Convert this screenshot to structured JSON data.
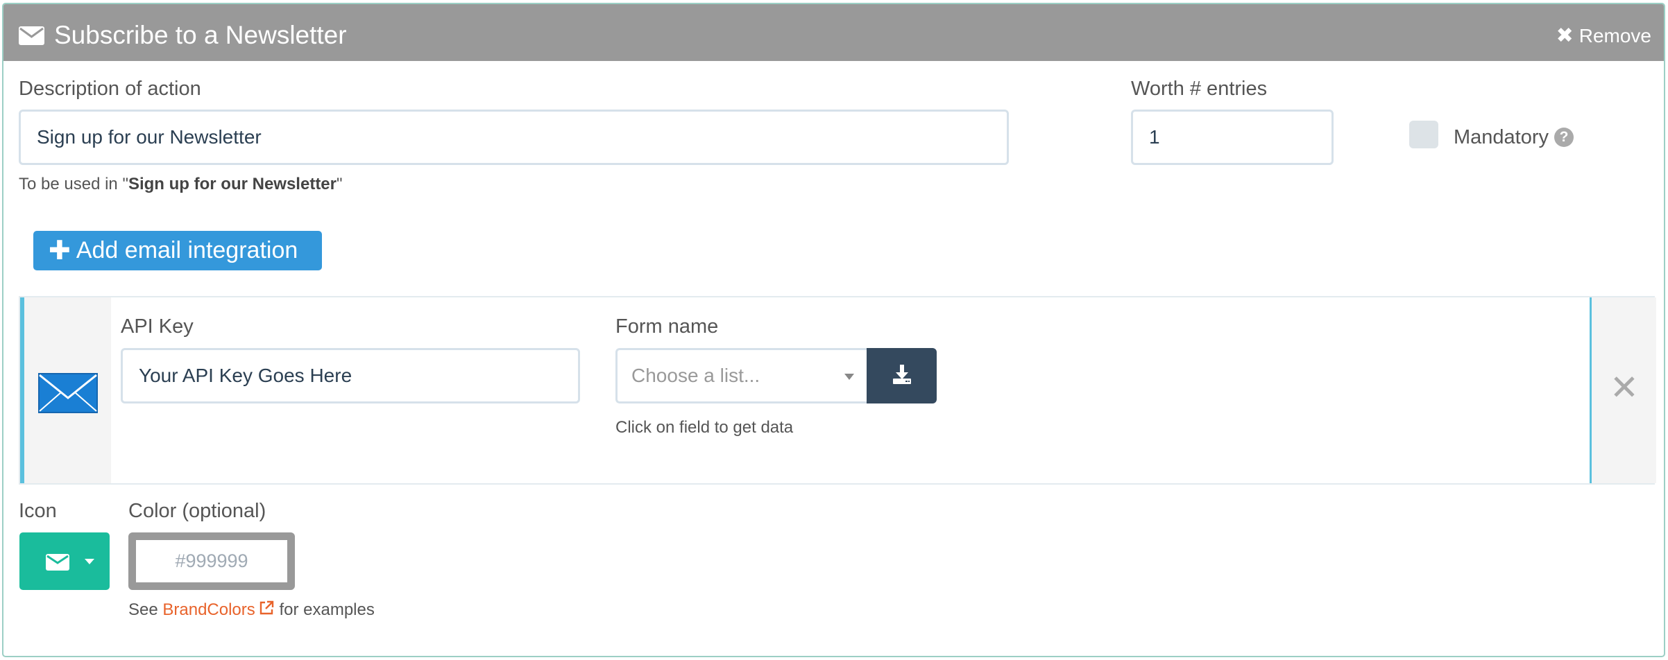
{
  "header": {
    "title": "Subscribe to a Newsletter",
    "remove_label": "Remove",
    "icon": "envelope-icon"
  },
  "description": {
    "label": "Description of action",
    "value": "Sign up for our Newsletter",
    "help_prefix": "To be used in \"",
    "help_bold": "Sign up for our Newsletter",
    "help_suffix": "\""
  },
  "worth": {
    "label": "Worth # entries",
    "value": "1"
  },
  "mandatory": {
    "label": "Mandatory",
    "checked": false,
    "help_icon": "question-circle-icon"
  },
  "add_integration": {
    "label": "Add email integration",
    "icon": "plus-icon"
  },
  "integration": {
    "icon": "email-envelope-icon",
    "api_key_label": "API Key",
    "api_key_value": "Your API Key Goes Here",
    "form_name_label": "Form name",
    "form_name_placeholder": "Choose a list...",
    "form_name_help": "Click on field to get data",
    "fetch_icon": "download-icon",
    "close_icon": "close-icon"
  },
  "icon_field": {
    "label": "Icon",
    "selected_icon": "envelope-icon"
  },
  "color_field": {
    "label": "Color (optional)",
    "placeholder": "#999999",
    "help_prefix": "See ",
    "help_link": "BrandColors",
    "help_suffix": " for examples"
  },
  "colors": {
    "header_bg": "#999999",
    "primary_button": "#3498db",
    "teal_button": "#1abc9c",
    "dark_button": "#34495e",
    "accent_bar": "#5bc0de",
    "link": "#e8632b"
  }
}
